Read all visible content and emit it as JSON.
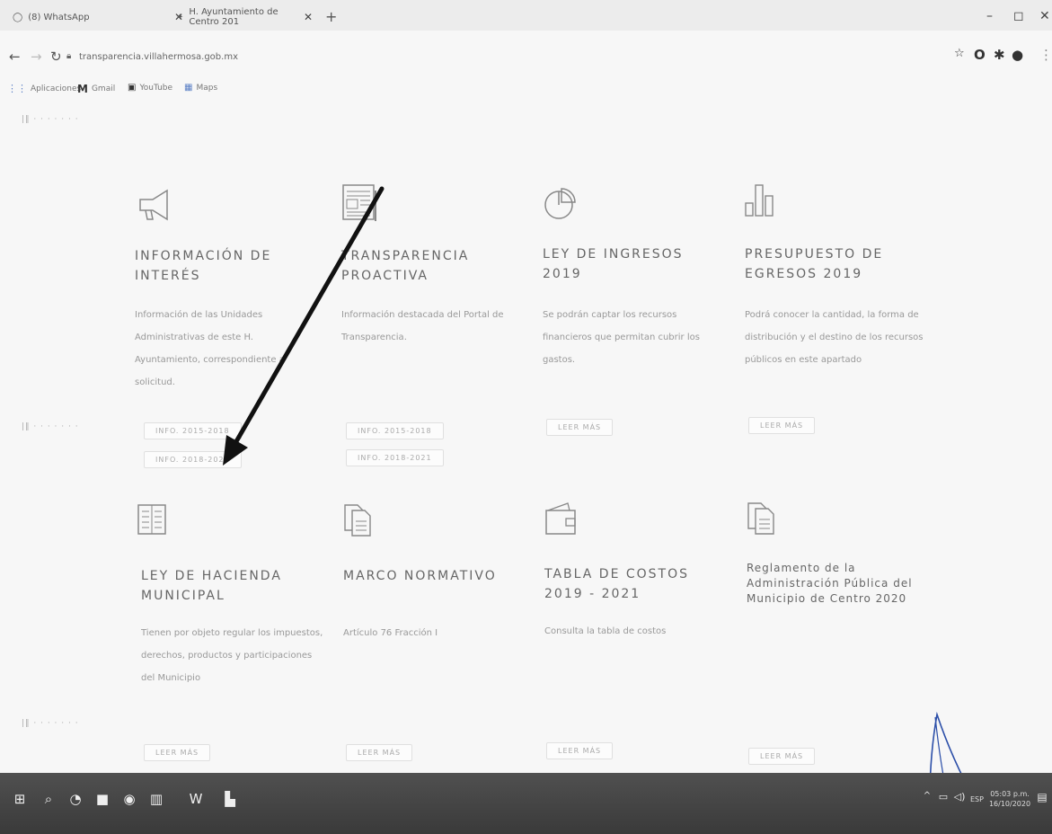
{
  "browser": {
    "tabs": [
      {
        "label": "(8) WhatsApp"
      },
      {
        "label": "H. Ayuntamiento de Centro 201"
      }
    ],
    "url": "transparencia.villahermosa.gob.mx",
    "bookmarks": [
      "Aplicaciones",
      "Gmail",
      "YouTube",
      "Maps"
    ]
  },
  "cards_row1": [
    {
      "title": "INFORMACIÓN DE INTERÉS",
      "desc": "Información de las Unidades Administrativas de este H. Ayuntamiento, correspondiente a solicitud.",
      "buttons": [
        "INFO. 2015-2018",
        "INFO. 2018-2021"
      ],
      "icon": "megaphone-icon"
    },
    {
      "title": "TRANSPARENCIA PROACTIVA",
      "desc": "Información destacada del Portal de Transparencia.",
      "buttons": [
        "INFO. 2015-2018",
        "INFO. 2018-2021"
      ],
      "icon": "newspaper-icon"
    },
    {
      "title": "LEY DE INGRESOS 2019",
      "desc": "Se podrán captar los recursos financieros que permitan cubrir los gastos.",
      "buttons": [
        "LEER MÁS"
      ],
      "icon": "pie-chart-icon"
    },
    {
      "title": "PRESUPUESTO DE EGRESOS 2019",
      "desc": "Podrá conocer la cantidad, la forma de distribución y el destino de los recursos públicos en este apartado",
      "buttons": [
        "LEER MÁS"
      ],
      "icon": "bar-chart-icon"
    }
  ],
  "cards_row2": [
    {
      "title": "LEY DE HACIENDA MUNICIPAL",
      "desc": "Tienen por objeto regular los impuestos, derechos, productos y participaciones del Municipio",
      "buttons": [
        "LEER MÁS"
      ],
      "icon": "ledger-icon"
    },
    {
      "title": "MARCO NORMATIVO",
      "desc": "Artículo 76 Fracción I",
      "buttons": [
        "LEER MÁS"
      ],
      "icon": "documents-icon"
    },
    {
      "title": "TABLA DE COSTOS 2019 - 2021",
      "desc": "Consulta la tabla de costos",
      "buttons": [
        "LEER MÁS"
      ],
      "icon": "wallet-icon"
    },
    {
      "title": "Reglamento de la Administración Pública del Municipio de Centro 2020",
      "desc": "",
      "buttons": [
        "LEER MÁS"
      ],
      "icon": "documents-icon"
    }
  ],
  "taskbar": {
    "lang": "ESP",
    "time": "05:03 p.m.",
    "date": "16/10/2020"
  }
}
